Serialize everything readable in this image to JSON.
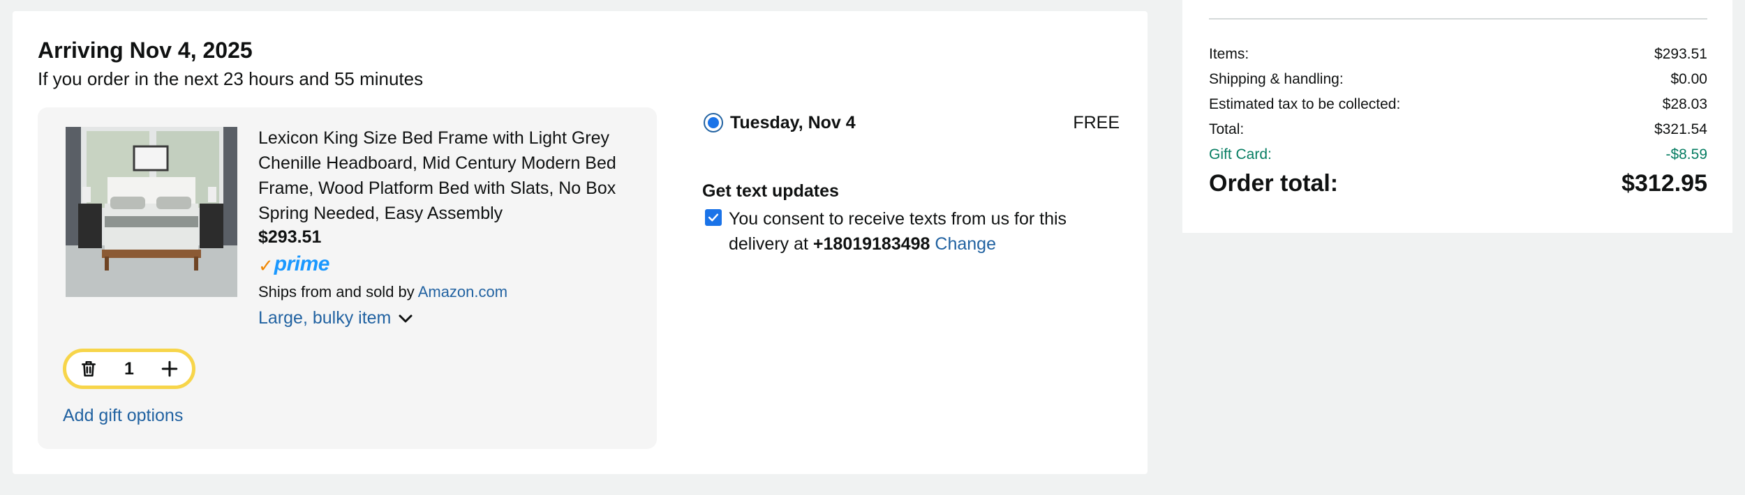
{
  "delivery": {
    "arriving": "Arriving Nov 4, 2025",
    "order_within": "If you order in the next 23 hours and 55 minutes",
    "option_date": "Tuesday, Nov 4",
    "option_price": "FREE"
  },
  "product": {
    "title": "Lexicon King Size Bed Frame with Light Grey Chenille Headboard, Mid Century Modern Bed Frame, Wood Platform Bed with Slats, No Box Spring Needed, Easy Assembly",
    "price": "$293.51",
    "prime_check": "✓",
    "prime_label": "prime",
    "ships_prefix": "Ships from and sold by",
    "seller": "Amazon.com",
    "bulky_label": "Large, bulky item",
    "quantity": "1",
    "gift_link": "Add gift options",
    "image_icon": "bed-frame-product-photo"
  },
  "text_updates": {
    "title": "Get text updates",
    "consent_prefix": "You consent to receive texts from us for this delivery at",
    "phone": "+18019183498",
    "change": "Change",
    "checked": true
  },
  "summary": {
    "rows": [
      {
        "label": "Items:",
        "value": "$293.51"
      },
      {
        "label": "Shipping & handling:",
        "value": "$0.00"
      },
      {
        "label": "Estimated tax to be collected:",
        "value": "$28.03"
      },
      {
        "label": "Total:",
        "value": "$321.54"
      },
      {
        "label": "Gift Card:",
        "value": "-$8.59"
      }
    ],
    "order_total_label": "Order total:",
    "order_total_value": "$312.95"
  },
  "colors": {
    "link": "#2162a1",
    "prime_blue": "#1a98ff",
    "prime_orange": "#f08804",
    "stepper_border": "#f7d54a",
    "gift_green": "#067d62"
  }
}
